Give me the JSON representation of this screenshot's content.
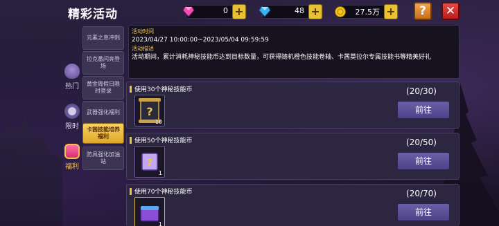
{
  "header": {
    "title": "精彩活动",
    "currencies": [
      {
        "icon": "pink-gem-icon",
        "value": "0"
      },
      {
        "icon": "blue-diamond-icon",
        "value": "48"
      },
      {
        "icon": "gold-coin-icon",
        "value": "27.5万"
      }
    ],
    "help_label": "?",
    "close_label": "✕"
  },
  "categories": [
    {
      "label": "热门",
      "icon": "hot-icon"
    },
    {
      "label": "限时",
      "icon": "timer-icon"
    },
    {
      "label": "福利",
      "icon": "gift-icon",
      "active": true
    }
  ],
  "submenu": [
    {
      "label": "元素之息冲刺"
    },
    {
      "label": "拉克番闪亮登场"
    },
    {
      "label": "黄金周假日限时登录"
    },
    {
      "label": "武器强化福利"
    },
    {
      "label": "卡茜技能培养福利",
      "active": true
    },
    {
      "label": "防具强化加油站"
    }
  ],
  "info": {
    "time_label": "活动时间",
    "time_value": "2023/04/27 10:00:00~2023/05/04 09:59:59",
    "desc_label": "活动描述",
    "desc_value": "活动期间，累计消耗神秘技能币达到目标数量，可获得随机橙色技能卷轴、卡茜莫拉尔专属技能书等精美好礼"
  },
  "tasks": [
    {
      "name": "使用30个神秘技能币",
      "progress": "(20/30)",
      "reward_qty": "10",
      "reward_icon": "skill-scroll-icon",
      "button": "前往"
    },
    {
      "name": "使用50个神秘技能币",
      "progress": "(20/50)",
      "reward_qty": "1",
      "reward_icon": "mystery-book-icon",
      "button": "前往"
    },
    {
      "name": "使用70个神秘技能币",
      "progress": "(20/70)",
      "reward_qty": "1",
      "reward_icon": "purple-chest-icon",
      "button": "前往"
    }
  ]
}
